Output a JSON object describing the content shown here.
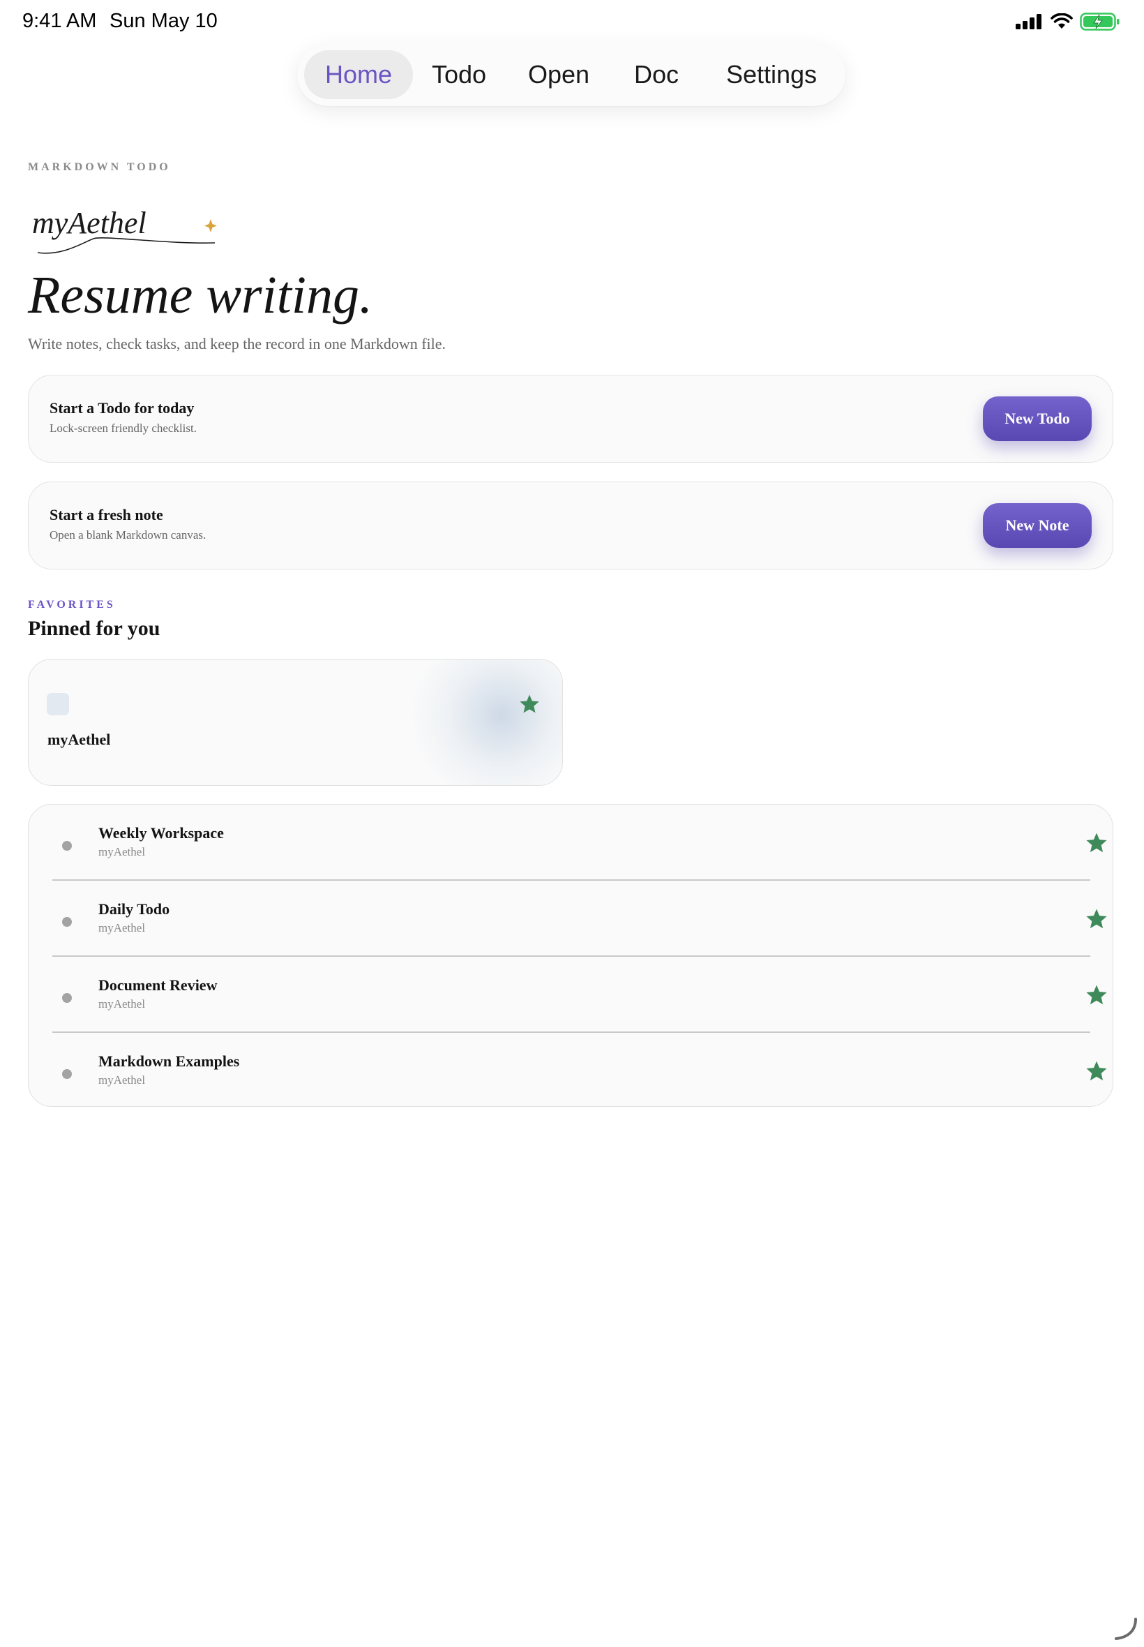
{
  "status_bar": {
    "time": "9:41 AM",
    "date": "Sun May 10",
    "icons": [
      "cellular-signal-icon",
      "wifi-icon",
      "battery-charging-icon"
    ]
  },
  "nav": {
    "tabs": [
      {
        "label": "Home",
        "active": true
      },
      {
        "label": "Todo",
        "active": false
      },
      {
        "label": "Open",
        "active": false
      },
      {
        "label": "Doc",
        "active": false
      },
      {
        "label": "Settings",
        "active": false
      }
    ]
  },
  "header": {
    "eyebrow": "MARKDOWN TODO",
    "logo_text": "myAethel",
    "title": "Resume writing.",
    "subtitle": "Write notes, check tasks, and keep the record in one Markdown file."
  },
  "actions": [
    {
      "title": "Start a Todo for today",
      "description": "Lock-screen friendly checklist.",
      "button": "New Todo"
    },
    {
      "title": "Start a fresh note",
      "description": "Open a blank Markdown canvas.",
      "button": "New Note"
    }
  ],
  "favorites": {
    "eyebrow": "FAVORITES",
    "title": "Pinned for you",
    "pinned": {
      "title": "myAethel",
      "starred": true
    },
    "items": [
      {
        "title": "Weekly Workspace",
        "subtitle": "myAethel",
        "starred": true
      },
      {
        "title": "Daily Todo",
        "subtitle": "myAethel",
        "starred": true
      },
      {
        "title": "Document Review",
        "subtitle": "myAethel",
        "starred": true
      },
      {
        "title": "Markdown Examples",
        "subtitle": "myAethel",
        "starred": true
      }
    ]
  },
  "colors": {
    "accent": "#6b54c4",
    "button": "#5f4db8",
    "star": "#3f8a5a",
    "eyebrow_gray": "#8a8a8a",
    "logo_sparkle": "#d9a43a",
    "battery": "#34c759"
  }
}
